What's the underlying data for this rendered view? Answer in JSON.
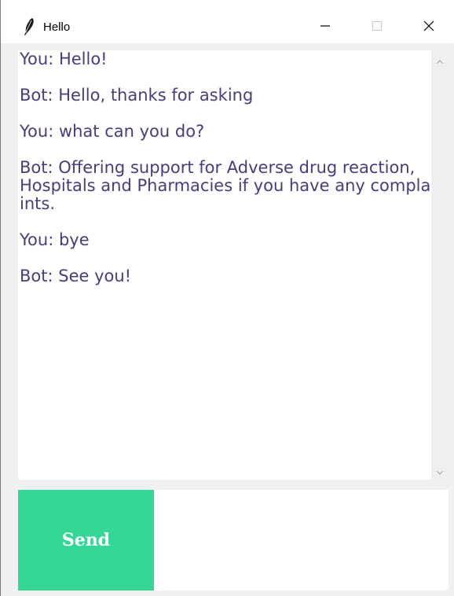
{
  "window": {
    "title": "Hello",
    "icon": "feather-icon",
    "controls": {
      "minimize": "minimize-icon",
      "maximize": "maximize-icon",
      "close": "close-icon"
    }
  },
  "chat": {
    "transcript": "You: Hello!\n\nBot: Hello, thanks for asking\n\nYou: what can you do?\n\nBot: Offering support for Adverse drug reaction, Hospitals and Pharmacies if you have any complaints.\n\nYou: bye\n\nBot: See you!",
    "text_color": "#4b3a7e"
  },
  "composer": {
    "send_label": "Send",
    "send_color": "#34d796",
    "input_value": ""
  }
}
